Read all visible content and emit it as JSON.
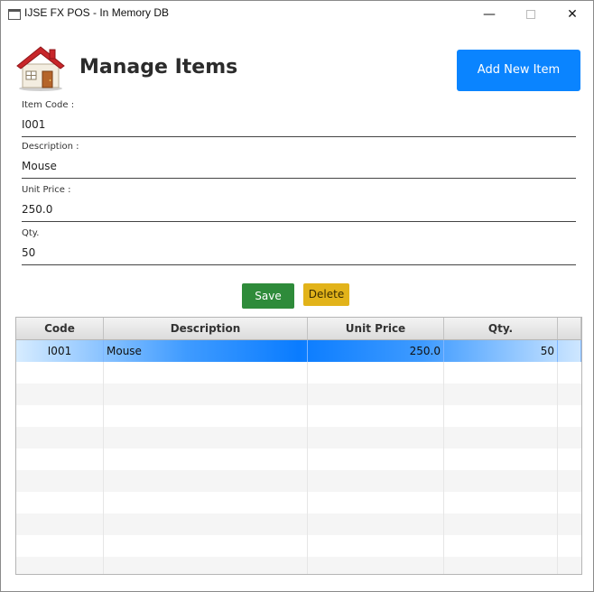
{
  "window": {
    "title": "IJSE FX POS - In Memory DB",
    "minimize_label": "—",
    "close_label": "✕"
  },
  "header": {
    "title": "Manage Items",
    "add_button_label": "Add New Item"
  },
  "form": {
    "item_code": {
      "label": "Item Code :",
      "value": "I001"
    },
    "description": {
      "label": "Description :",
      "value": "Mouse"
    },
    "unit_price": {
      "label": "Unit Price :",
      "value": "250.0"
    },
    "qty": {
      "label": "Qty.",
      "value": "50"
    }
  },
  "actions": {
    "save_label": "Save",
    "delete_label": "Delete"
  },
  "table": {
    "columns": [
      "Code",
      "Description",
      "Unit Price",
      "Qty."
    ],
    "rows": [
      {
        "code": "I001",
        "description": "Mouse",
        "unit_price": "250.0",
        "qty": "50"
      }
    ]
  },
  "colors": {
    "accent": "#0a84ff",
    "save": "#2e8b3a",
    "delete": "#e2b31a"
  }
}
